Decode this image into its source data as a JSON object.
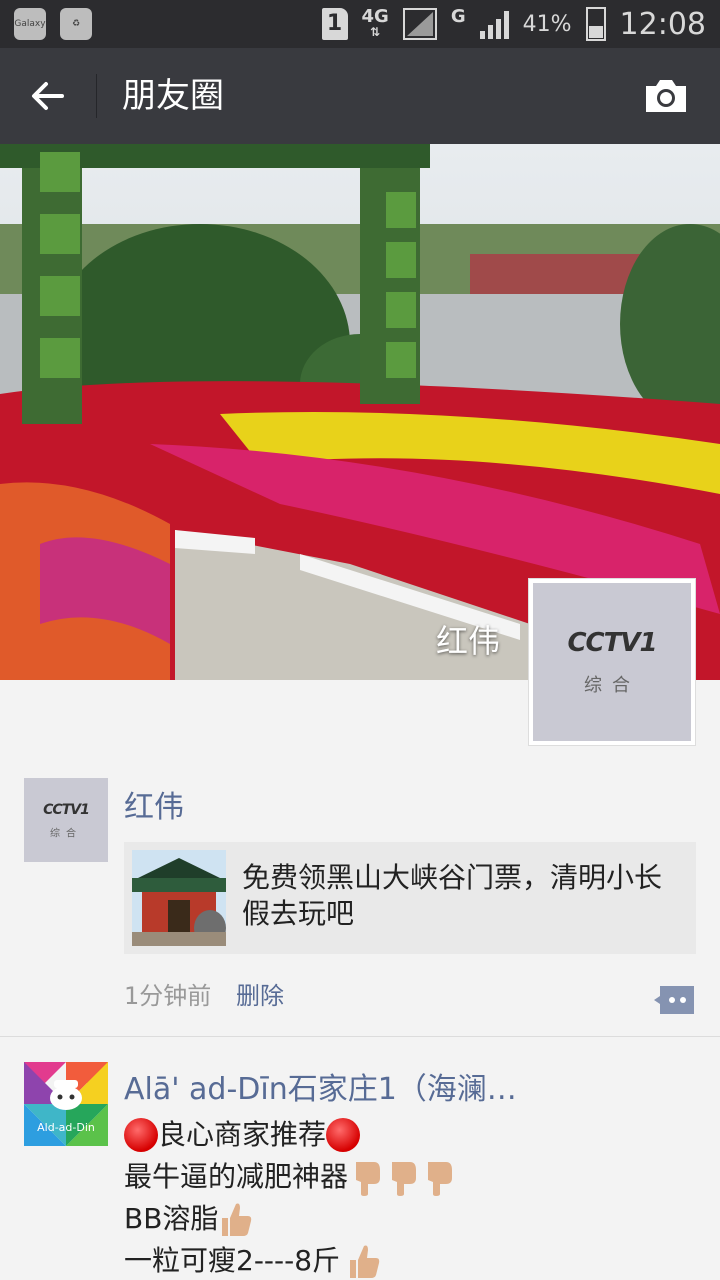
{
  "status_bar": {
    "sim_slot": "1",
    "network": "4G",
    "network2": "G",
    "battery": "41%",
    "time": "12:08",
    "left_icons": [
      "galaxy-icon",
      "recycle-icon"
    ]
  },
  "header": {
    "title": "朋友圈",
    "back_icon": "arrow-left-icon",
    "camera_icon": "camera-icon"
  },
  "cover": {
    "user_name": "红伟",
    "avatar_logo": "CCTV1",
    "avatar_sub": "综合"
  },
  "posts": [
    {
      "author": "红伟",
      "avatar_logo": "CCTV1",
      "avatar_sub": "综合",
      "share_text": "免费领黑山大峡谷门票，清明小长假去玩吧",
      "time": "1分钟前",
      "delete_label": "删除",
      "comment_icon": "comment-icon"
    },
    {
      "author": "Alā' ad-Dīn石家庄1（海澜…",
      "avatar_tag": "Ald-ad-Din",
      "lines": [
        "良心商家推荐",
        "最牛逼的减肥神器",
        "BB溶脂",
        "一粒可瘦2----8斤"
      ]
    }
  ],
  "colors": {
    "link": "#576b95",
    "header_bg": "#393a3f",
    "status_bg": "#2c2c2f"
  }
}
